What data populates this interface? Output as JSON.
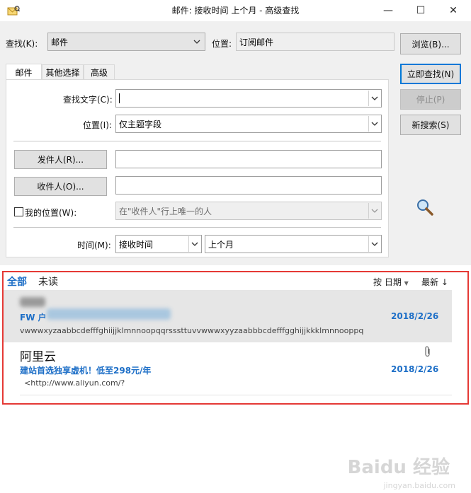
{
  "window": {
    "title": "邮件: 接收时间 上个月 - 高级查找",
    "minimize": "—",
    "maximize": "☐",
    "close": "✕"
  },
  "search": {
    "lookfor_label": "查找(K):",
    "lookfor_value": "邮件",
    "location_label": "位置:",
    "location_value": "订阅邮件",
    "browse_button": "浏览(B)..."
  },
  "tabs": [
    {
      "label": "邮件"
    },
    {
      "label": "其他选择"
    },
    {
      "label": "高级"
    }
  ],
  "form": {
    "search_text_label": "查找文字(C):",
    "search_text_value": "",
    "in_label": "位置(I):",
    "in_value": "仅主题字段",
    "from_button": "发件人(R)...",
    "sent_to_button": "收件人(O)...",
    "where_label": "我的位置(W):",
    "where_value": "在\"收件人\"行上唯一的人",
    "time_label": "时间(M):",
    "time_field": "接收时间",
    "time_range": "上个月"
  },
  "actions": {
    "find_now": "立即查找(N)",
    "stop": "停止(P)",
    "new_search": "新搜索(S)"
  },
  "results": {
    "filter_all": "全部",
    "filter_unread": "未读",
    "sort_by": "按 日期",
    "sort_order": "最新 ↓",
    "items": [
      {
        "sender": "",
        "subject": "FW 户",
        "date": "2018/2/26",
        "preview": "vwwwxyzaabbcdefffghiijjklmnnoopqqrsssttuvvwwwxyyzaabbbcdefffgghijjkkklmnnooppq"
      },
      {
        "sender": "阿里云",
        "subject": "建站首选独享虚机！低至298元/年",
        "date": "2018/2/26",
        "preview": "<http://www.aliyun.com/?"
      }
    ]
  },
  "watermark": {
    "text": "Baidu 经验",
    "sub": "jingyan.baidu.com"
  },
  "colors": {
    "accent": "#1e6fc7",
    "highlight_frame": "#e53935",
    "selected_row": "#e6e6e6"
  }
}
